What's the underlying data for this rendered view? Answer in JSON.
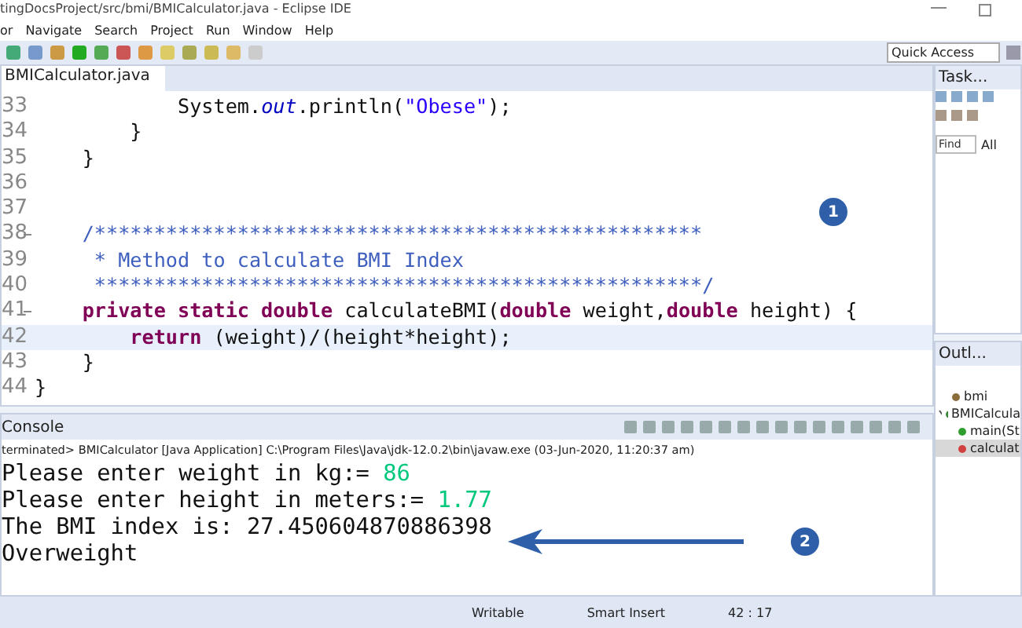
{
  "window": {
    "title": "tingDocsProject/src/bmi/BMICalculator.java - Eclipse IDE"
  },
  "menu": [
    "or",
    "Navigate",
    "Search",
    "Project",
    "Run",
    "Window",
    "Help"
  ],
  "quick_access": {
    "placeholder": "Quick Access"
  },
  "editor": {
    "tab": "BMICalculator.java",
    "lines": [
      {
        "number": "33",
        "fold": false,
        "current": false,
        "segments": [
          {
            "kind": "plain",
            "text": "            System."
          },
          {
            "kind": "field",
            "text": "out"
          },
          {
            "kind": "plain",
            "text": ".println("
          },
          {
            "kind": "string",
            "text": "\"Obese\""
          },
          {
            "kind": "plain",
            "text": ");"
          }
        ]
      },
      {
        "number": "34",
        "fold": false,
        "current": false,
        "segments": [
          {
            "kind": "plain",
            "text": "        }"
          }
        ]
      },
      {
        "number": "35",
        "fold": false,
        "current": false,
        "segments": [
          {
            "kind": "plain",
            "text": "    }"
          }
        ]
      },
      {
        "number": "36",
        "fold": false,
        "current": false
      },
      {
        "number": "37",
        "fold": false,
        "current": false
      },
      {
        "number": "38",
        "fold": true,
        "current": false,
        "segments": [
          {
            "kind": "comment",
            "text": "    /***************************************************"
          }
        ]
      },
      {
        "number": "39",
        "fold": false,
        "current": false,
        "segments": [
          {
            "kind": "comment",
            "text": "     * Method to calculate BMI Index"
          }
        ]
      },
      {
        "number": "40",
        "fold": false,
        "current": false,
        "segments": [
          {
            "kind": "comment",
            "text": "     ***************************************************/"
          }
        ]
      },
      {
        "number": "41",
        "fold": true,
        "current": false,
        "segments": [
          {
            "kind": "keyword",
            "text": "    private static double"
          },
          {
            "kind": "plain",
            "text": " calculateBMI("
          },
          {
            "kind": "keyword",
            "text": "double"
          },
          {
            "kind": "plain",
            "text": " weight,"
          },
          {
            "kind": "keyword",
            "text": "double"
          },
          {
            "kind": "plain",
            "text": " height) {"
          }
        ]
      },
      {
        "number": "42",
        "fold": false,
        "current": true,
        "segments": [
          {
            "kind": "keyword",
            "text": "        return"
          },
          {
            "kind": "plain",
            "text": " (weight)/(height*height);"
          }
        ]
      },
      {
        "number": "43",
        "fold": false,
        "current": false,
        "segments": [
          {
            "kind": "plain",
            "text": "    }"
          }
        ]
      },
      {
        "number": "44",
        "fold": false,
        "current": false,
        "segments": [
          {
            "kind": "plain",
            "text": "}"
          }
        ]
      }
    ]
  },
  "console": {
    "title": "Console",
    "status": "terminated> BMICalculator [Java Application] C:\\Program Files\\Java\\jdk-12.0.2\\bin\\javaw.exe (03-Jun-2020, 11:20:37 am)",
    "lines": [
      [
        {
          "kind": "output",
          "text": "Please enter weight in kg:= "
        },
        {
          "kind": "input",
          "text": "86"
        }
      ],
      [
        {
          "kind": "output",
          "text": "Please enter height in meters:= "
        },
        {
          "kind": "input",
          "text": "1.77"
        }
      ],
      [
        {
          "kind": "output",
          "text": "The BMI index is: 27.450604870886398"
        }
      ],
      [
        {
          "kind": "output",
          "text": "Overweight"
        }
      ]
    ]
  },
  "task_panel": {
    "title": "Task...",
    "find": {
      "placeholder": "Find"
    },
    "filter": "All"
  },
  "outline": {
    "title": "Outl...",
    "items": [
      {
        "label": "bmi",
        "kind": "package",
        "selected": false,
        "expanded": false
      },
      {
        "label": "BMICalcula",
        "kind": "class",
        "selected": false,
        "expanded": true,
        "children": [
          {
            "label": "main(St",
            "kind": "public-method",
            "selected": false
          },
          {
            "label": "calculat",
            "kind": "private-method",
            "selected": true
          }
        ]
      }
    ]
  },
  "status_bar": [
    "Writable",
    "Smart Insert",
    "42 : 17"
  ],
  "annotations": [
    "1",
    "2"
  ]
}
